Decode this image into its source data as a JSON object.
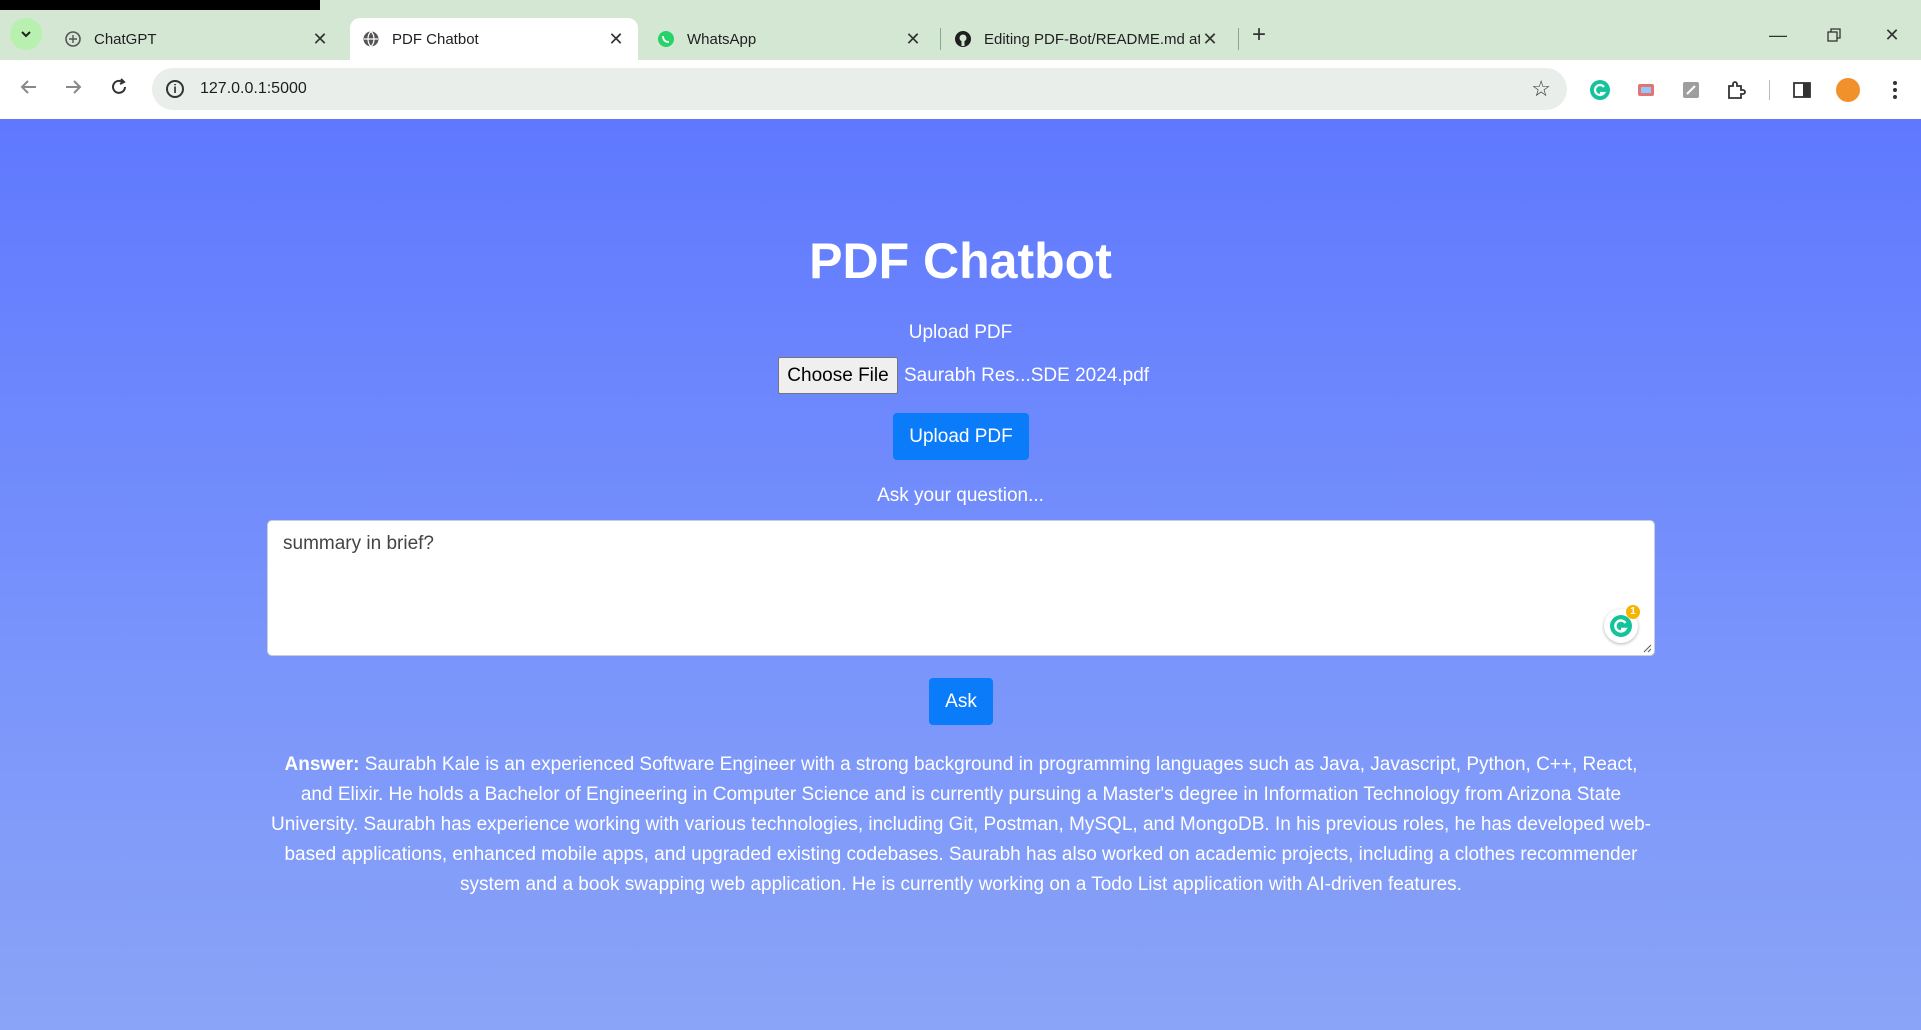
{
  "browser": {
    "tabs": [
      {
        "title": "ChatGPT",
        "icon": "chatgpt-icon"
      },
      {
        "title": "PDF Chatbot",
        "icon": "globe-icon",
        "active": true
      },
      {
        "title": "WhatsApp",
        "icon": "whatsapp-icon"
      },
      {
        "title": "Editing PDF-Bot/README.md at",
        "icon": "github-icon"
      }
    ],
    "url": "127.0.0.1:5000"
  },
  "app": {
    "title": "PDF Chatbot",
    "upload_label": "Upload PDF",
    "choose_file_label": "Choose File",
    "selected_file": "Saurabh Res...SDE 2024.pdf",
    "upload_button": "Upload PDF",
    "ask_label": "Ask your question...",
    "question_value": "summary in brief?",
    "grammarly_count": "1",
    "ask_button": "Ask",
    "answer_label": "Answer:",
    "answer_text": "Saurabh Kale is an experienced Software Engineer with a strong background in programming languages such as Java, Javascript, Python, C++, React, and Elixir. He holds a Bachelor of Engineering in Computer Science and is currently pursuing a Master's degree in Information Technology from Arizona State University. Saurabh has experience working with various technologies, including Git, Postman, MySQL, and MongoDB. In his previous roles, he has developed web-based applications, enhanced mobile apps, and upgraded existing codebases. Saurabh has also worked on academic projects, including a clothes recommender system and a book swapping web application. He is currently working on a Todo List application with AI-driven features."
  },
  "colors": {
    "page_gradient_top": "#5f78ff",
    "page_gradient_bottom": "#8aa4f7",
    "button_blue": "#0a7bf9",
    "tabbar": "#d4e7d3"
  }
}
